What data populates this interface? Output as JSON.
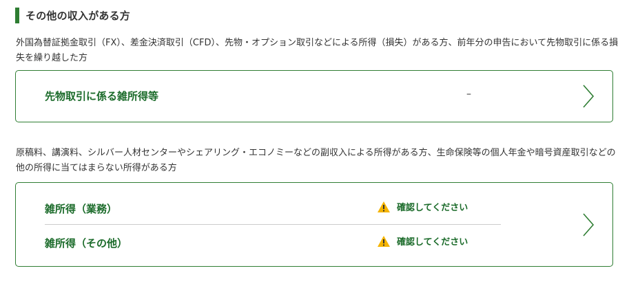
{
  "section": {
    "title": "その他の収入がある方"
  },
  "group1": {
    "description": "外国為替証拠金取引（FX）、差金決済取引（CFD）、先物・オプション取引などによる所得（損失）がある方、前年分の申告において先物取引に係る損失を繰り越した方",
    "rows": [
      {
        "label": "先物取引に係る雑所得等",
        "value": "–"
      }
    ]
  },
  "group2": {
    "description": "原稿料、講演料、シルバー人材センターやシェアリング・エコノミーなどの副収入による所得がある方、生命保険等の個人年金や暗号資産取引などの他の所得に当てはまらない所得がある方",
    "rows": [
      {
        "label": "雑所得（業務）",
        "status": "確認してください"
      },
      {
        "label": "雑所得（その他）",
        "status": "確認してください"
      }
    ]
  },
  "colors": {
    "accent": "#2e7d32",
    "label_green": "#1b6b2a",
    "warning": "#f5b400"
  },
  "icons": {
    "warning": "warning-icon",
    "chevron": "chevron-right-icon"
  }
}
